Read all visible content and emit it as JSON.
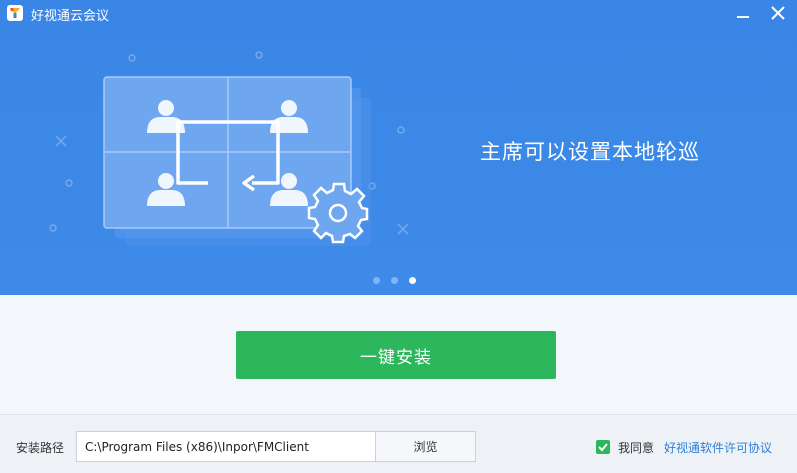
{
  "window": {
    "title": "好视通云会议",
    "logo_icon": "app-logo-icon",
    "minimize_icon": "minimize-icon",
    "close_icon": "close-icon"
  },
  "banner": {
    "background_color": "#3a86e6",
    "caption": "主席可以设置本地轮巡",
    "illustration_icon": "video-grid-rotation-icon",
    "carousel": {
      "total": 3,
      "active_index": 2
    }
  },
  "install": {
    "button_label": "一键安装",
    "button_color": "#2cb75c"
  },
  "footer": {
    "path_label": "安装路径",
    "path_value": "C:\\Program Files (x86)\\Inpor\\FMClient",
    "browse_label": "浏览",
    "agree_checked": true,
    "agree_label": "我同意",
    "license_link": "好视通软件许可协议",
    "link_color": "#2f7fd8"
  }
}
